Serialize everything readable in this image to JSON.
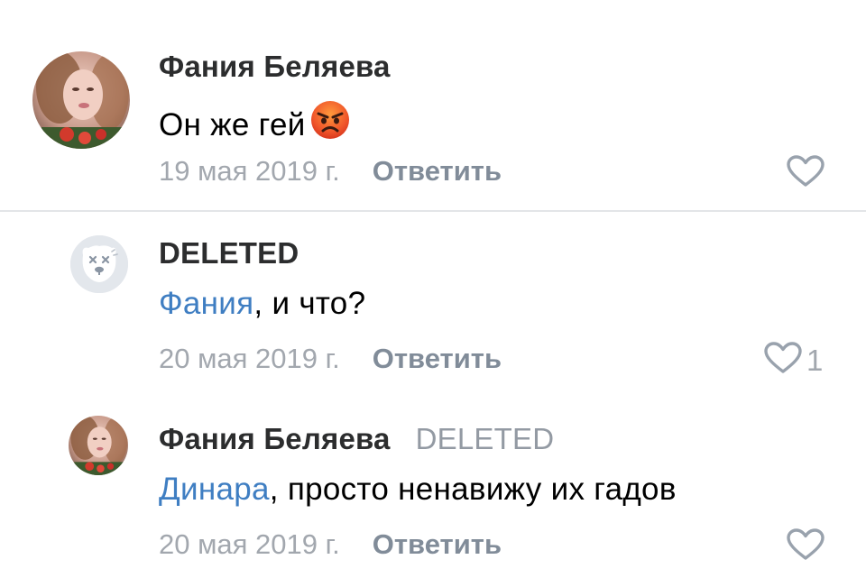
{
  "comments": [
    {
      "author": "Фания Беляева",
      "reply_to": "",
      "mention": "",
      "text": "Он же гей",
      "emoji": "angry-face-emoji",
      "date": "19 мая 2019 г.",
      "reply_label": "Ответить",
      "likes": ""
    },
    {
      "author": "DELETED",
      "reply_to": "",
      "mention": "Фания",
      "text": ", и что?",
      "date": "20 мая 2019 г.",
      "reply_label": "Ответить",
      "likes": "1"
    },
    {
      "author": "Фания Беляева",
      "reply_to": "DELETED",
      "mention": "Динара",
      "text": ", просто ненавижу их гадов",
      "date": "20 мая 2019 г.",
      "reply_label": "Ответить",
      "likes": ""
    }
  ],
  "icons": {
    "like": "heart-outline-icon",
    "deleted_avatar": "deleted-dog-avatar-icon"
  },
  "colors": {
    "mention": "#3f7ec2",
    "secondary": "#a2a7ae",
    "reply_button": "#818c99",
    "divider": "#e3e5e8"
  }
}
